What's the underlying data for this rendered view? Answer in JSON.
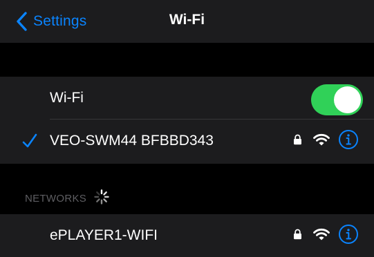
{
  "colors": {
    "accent": "#0a84ff",
    "toggle_on": "#30d158",
    "cell_background": "#1c1c1e",
    "page_background": "#000000",
    "section_header": "#5e5e62"
  },
  "navbar": {
    "back_label": "Settings",
    "back_icon": "chevron-left-icon",
    "title": "Wi-Fi"
  },
  "wifi_toggle": {
    "label": "Wi-Fi",
    "on": true
  },
  "connected_network": {
    "name": "VEO-SWM44 BFBBD343",
    "selected_icon": "checkmark-icon",
    "secured": true,
    "icons": [
      "lock-icon",
      "wifi-signal-icon",
      "info-icon"
    ]
  },
  "networks_section": {
    "header": "NETWORKS",
    "loading": true
  },
  "networks": [
    {
      "name": "ePLAYER1-WIFI",
      "secured": true,
      "icons": [
        "lock-icon",
        "wifi-signal-icon",
        "info-icon"
      ]
    }
  ]
}
